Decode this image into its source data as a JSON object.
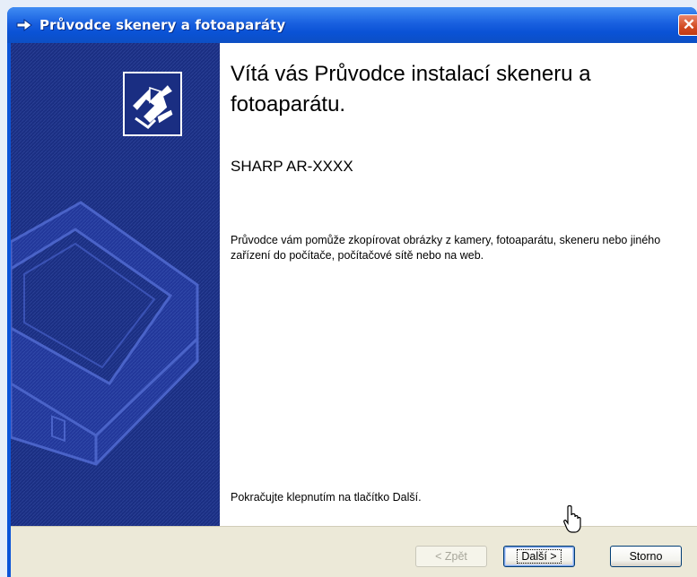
{
  "window": {
    "title": "Průvodce skenery a fotoaparáty",
    "close_label": "✕"
  },
  "welcome": {
    "heading": "Vítá vás Průvodce instalací skeneru a fotoaparátu.",
    "device_name": "SHARP AR-XXXX",
    "description": "Průvodce vám pomůže zkopírovat obrázky z kamery, fotoaparátu, skeneru nebo jiného zařízení do počítače, počítačové sítě nebo na web.",
    "continue_text": "Pokračujte klepnutím na tlačítko Další."
  },
  "buttons": {
    "back": "< Zpět",
    "next": "Další >",
    "cancel": "Storno"
  },
  "colors": {
    "sidebar": "#1a2e82",
    "titlebar": "#0a54d8",
    "footer": "#ece9d8"
  },
  "icons": {
    "title": "wizard-arrow-icon",
    "logo": "wizard-logo-icon",
    "illustration": "scanner-illustration",
    "cursor": "mouse-pointer-icon"
  }
}
